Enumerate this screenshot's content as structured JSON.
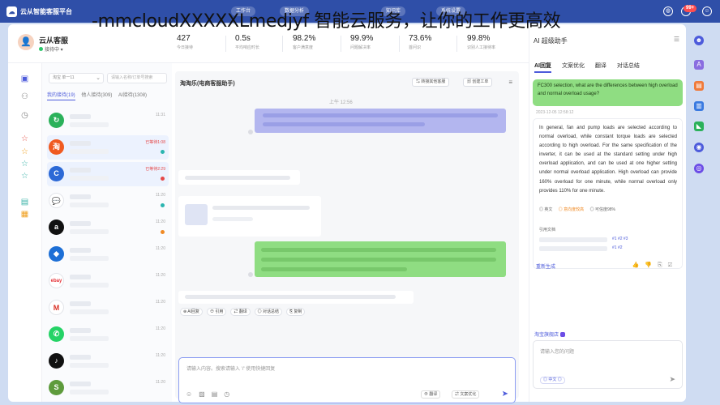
{
  "overlay_text": "-mmcloudXXXXXLmedjyf 智能云服务，让你的工作更高效",
  "topbar": {
    "app_name": "云从智能客服平台",
    "pills": [
      "工作台",
      "数据分析",
      "知识库",
      "系统设置"
    ],
    "badge": "99+"
  },
  "user": {
    "avatar": "👤",
    "name": "云从客服",
    "status": "接待中 ▾"
  },
  "stats": [
    {
      "value": "427",
      "label": "今日接待"
    },
    {
      "value": "0.5s",
      "label": "平均响应时长"
    },
    {
      "value": "98.2%",
      "label": "客户满意度"
    },
    {
      "value": "99.9%",
      "label": "问题解决率"
    },
    {
      "value": "73.6%",
      "label": "首问识"
    },
    {
      "value": "99.8%",
      "label": "识别人工接待率"
    }
  ],
  "conversations": {
    "filter": "淘宝 单一11",
    "search_placeholder": "请输入名称/订单号搜索",
    "tabs": [
      "我的接待(19)",
      "他人接待(309)",
      "AI接待(1308)"
    ],
    "items": [
      {
        "logo": "↻",
        "color": "#2bb15a",
        "time": "11:31",
        "time_alert": false,
        "dot": ""
      },
      {
        "logo": "淘",
        "color": "#f05a21",
        "time": "已等待1:08",
        "time_alert": true,
        "dot": "#2bb5b0"
      },
      {
        "logo": "C",
        "color": "#2c69d6",
        "time": "已等待2:29",
        "time_alert": true,
        "dot": "#e54848"
      },
      {
        "logo": "💬",
        "color": "#ffffff",
        "time": "11:20",
        "time_alert": false,
        "dot": "#2bb5b0"
      },
      {
        "logo": "a",
        "color": "#111111",
        "time": "11:20",
        "time_alert": false,
        "dot": "#f08a24"
      },
      {
        "logo": "◆",
        "color": "#1d6fd6",
        "time": "11:20",
        "time_alert": false,
        "dot": ""
      },
      {
        "logo": "ebay",
        "color": "#ffffff",
        "time": "11:20",
        "time_alert": false,
        "dot": ""
      },
      {
        "logo": "M",
        "color": "#ffffff",
        "time": "11:20",
        "time_alert": false,
        "dot": ""
      },
      {
        "logo": "✆",
        "color": "#25d366",
        "time": "11:20",
        "time_alert": false,
        "dot": ""
      },
      {
        "logo": "♪",
        "color": "#111111",
        "time": "11:20",
        "time_alert": false,
        "dot": ""
      },
      {
        "logo": "S",
        "color": "#5e9b3c",
        "time": "11:20",
        "time_alert": false,
        "dot": ""
      }
    ]
  },
  "chat": {
    "title": "淘淘乐(电商客服助手)",
    "transfer_label": "⇆ 转接其他客服",
    "ticket_label": "🗐 创建工单",
    "time_label": "上午 12:56",
    "actions": [
      "⊕ AI回复",
      "⊖ 引用",
      "⇄ 翻译",
      "◎ 对话总结",
      "⎘ 复制"
    ],
    "input_hint": "请输入内容。搜索请输入 '/' 使用快捷回复",
    "translate_label": "⊕ 翻译",
    "polish_label": "⇄ 文案优化"
  },
  "ai": {
    "title": "AI 超级助手",
    "tabs": [
      "AI回复",
      "文案优化",
      "翻译",
      "对话总结"
    ],
    "question": "FC300 selection, what are the differences between high overload and normal overload usage?",
    "question_time": "2023-12-05 12:58:12",
    "answer": "In general, fan and pump loads are selected according to normal overload, while constant torque loads are selected according to high overload. For the same specification of the inverter, it can be used at the standard setting under high overload application, and can be used at one higher setting under normal overload application. High overload can provide 160% overload for one minute, while normal overload only provides 110% for one minute.",
    "meta": [
      "◎ 英文",
      "◎ 意向度较高",
      "◎ 可信度98%"
    ],
    "ref_label": "引用文档",
    "refs": [
      "#1  #2  #3",
      "#1  #2"
    ],
    "regen_label": "重新生成",
    "shop_label": "淘宝旗舰店",
    "input_hint": "请输入您的问题",
    "lang_label": "◎ 中文 ◎"
  }
}
